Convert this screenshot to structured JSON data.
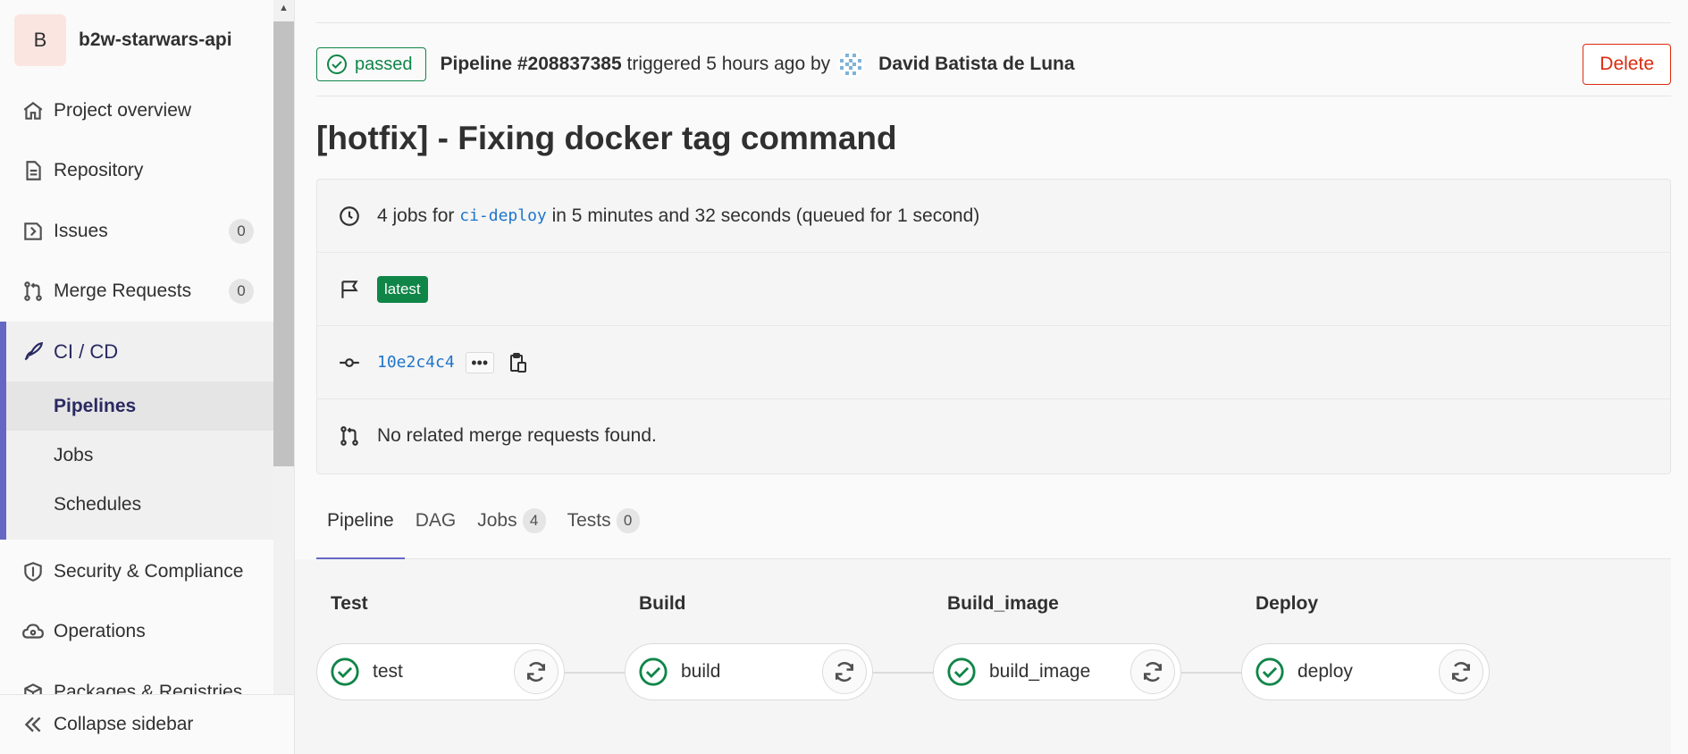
{
  "sidebar": {
    "project": {
      "avatar_letter": "B",
      "name": "b2w-starwars-api"
    },
    "items": [
      {
        "label": "Project overview",
        "icon": "home-icon"
      },
      {
        "label": "Repository",
        "icon": "document-icon"
      },
      {
        "label": "Issues",
        "icon": "issues-icon",
        "count": "0"
      },
      {
        "label": "Merge Requests",
        "icon": "merge-request-icon",
        "count": "0"
      }
    ],
    "cicd": {
      "label": "CI / CD",
      "icon": "rocket-icon",
      "sub_items": [
        {
          "label": "Pipelines",
          "active": true
        },
        {
          "label": "Jobs"
        },
        {
          "label": "Schedules"
        }
      ]
    },
    "items_after": [
      {
        "label": "Security & Compliance",
        "icon": "shield-icon"
      },
      {
        "label": "Operations",
        "icon": "cloud-gear-icon"
      },
      {
        "label": "Packages & Registries",
        "icon": "package-icon"
      }
    ],
    "collapse_label": "Collapse sidebar"
  },
  "header": {
    "status": "passed",
    "pipeline_label": "Pipeline #208837385",
    "triggered_text": "triggered 5 hours ago by",
    "user_name": "David Batista de Luna",
    "delete_label": "Delete"
  },
  "title": "[hotfix] - Fixing docker tag command",
  "info": {
    "jobs_prefix": "4 jobs for",
    "branch": "ci-deploy",
    "jobs_suffix": "in 5 minutes and 32 seconds (queued for 1 second)",
    "tag": "latest",
    "commit_sha": "10e2c4c4",
    "ellipsis": "•••",
    "merge_requests_text": "No related merge requests found."
  },
  "tabs": [
    {
      "label": "Pipeline",
      "active": true
    },
    {
      "label": "DAG"
    },
    {
      "label": "Jobs",
      "count": "4"
    },
    {
      "label": "Tests",
      "count": "0"
    }
  ],
  "stages": [
    {
      "title": "Test",
      "job": "test",
      "status": "success"
    },
    {
      "title": "Build",
      "job": "build",
      "status": "success"
    },
    {
      "title": "Build_image",
      "job": "build_image",
      "status": "success"
    },
    {
      "title": "Deploy",
      "job": "deploy",
      "status": "success"
    }
  ],
  "colors": {
    "success": "#108548",
    "danger": "#dd2b0e",
    "accent": "#6666c4",
    "link": "#1f75cb"
  }
}
